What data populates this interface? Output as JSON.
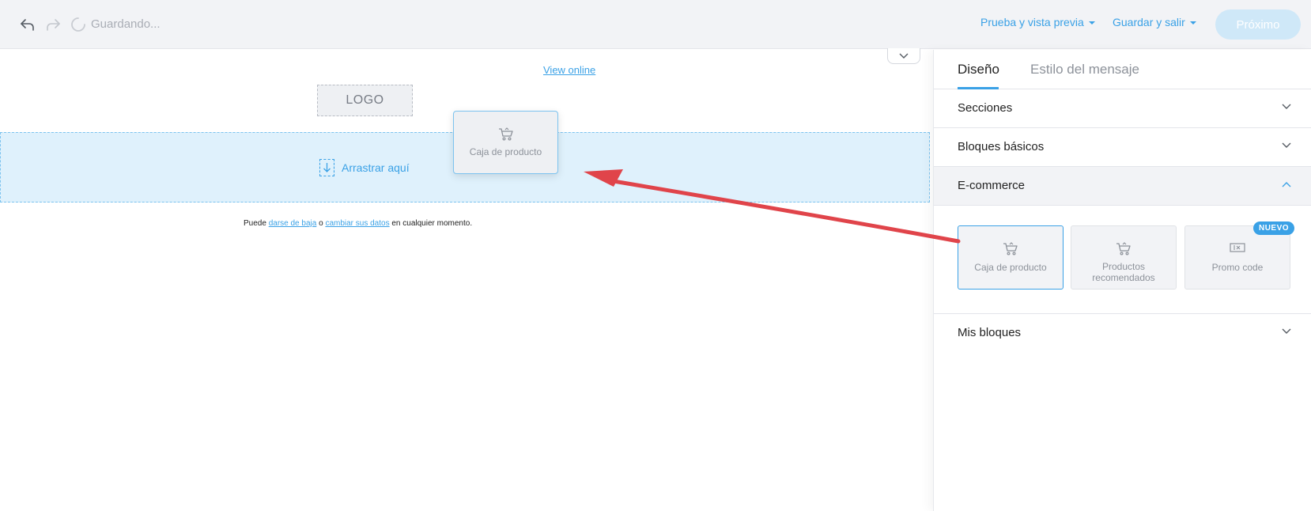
{
  "topbar": {
    "status": "Guardando...",
    "preview_label": "Prueba y vista previa",
    "save_exit_label": "Guardar y salir",
    "next_label": "Próximo"
  },
  "canvas": {
    "view_online": "View online",
    "logo": "LOGO",
    "drop_label": "Arrastrar aquí",
    "drag_ghost_label": "Caja de producto",
    "footer": {
      "prefix": "Puede ",
      "unsubscribe": "darse de baja",
      "middle": " o ",
      "change_data": "cambiar sus datos",
      "suffix": " en cualquier momento."
    }
  },
  "panel": {
    "tabs": [
      "Diseño",
      "Estilo del mensaje"
    ],
    "active_tab": "Diseño",
    "sections": {
      "sections": "Secciones",
      "basic_blocks": "Bloques básicos",
      "ecommerce": "E-commerce",
      "my_blocks": "Mis bloques"
    },
    "ecommerce_blocks": [
      {
        "label": "Caja de producto",
        "icon": "cart-icon"
      },
      {
        "label": "Productos recomendados",
        "icon": "cart-icon"
      },
      {
        "label": "Promo code",
        "icon": "ticket-icon"
      }
    ],
    "new_badge": "NUEVO"
  },
  "colors": {
    "accent": "#3aa1e6",
    "drop_zone": "#dff1fc",
    "arrow": "#e0444a",
    "topbar_bg": "#f2f3f6"
  }
}
